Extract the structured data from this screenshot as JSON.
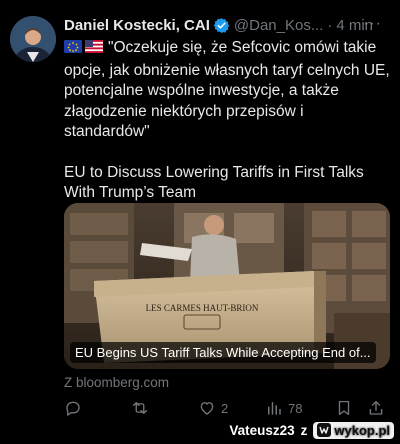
{
  "author": {
    "name": "Daniel Kostecki, CAI",
    "handle": "@Dan_Kos...",
    "separator": "·",
    "time": "4 min"
  },
  "tweet": {
    "quote": "\"Oczekuje się, że Sefcovic omówi takie opcje, jak obniżenie własnych taryf celnych UE, potencjalne wspólne inwestycje, a także złagodzenie niektórych przepisów i standardów\"",
    "headline": "EU to Discuss Lowering Tariffs in First Talks With Trump’s Team"
  },
  "card": {
    "title": "EU Begins US Tariff Talks While Accepting End of...",
    "crate_text": "LES CARMES HAUT-BRION",
    "source": "Z bloomberg.com"
  },
  "actions": {
    "reply_count": "",
    "retweet_count": "",
    "like_count": "2",
    "view_count": "78"
  },
  "watermark": {
    "user": "Vateusz23",
    "z": "z",
    "logo_text": "wykop.pl"
  },
  "icons": [
    "verified-icon",
    "more-icon",
    "reply-icon",
    "retweet-icon",
    "like-icon",
    "views-icon",
    "bookmark-icon",
    "share-icon",
    "eu-flag-icon",
    "us-flag-icon"
  ],
  "colors": {
    "background": "#000000",
    "text": "#e7e9ea",
    "muted": "#71767b",
    "verified": "#1d9bf0"
  }
}
